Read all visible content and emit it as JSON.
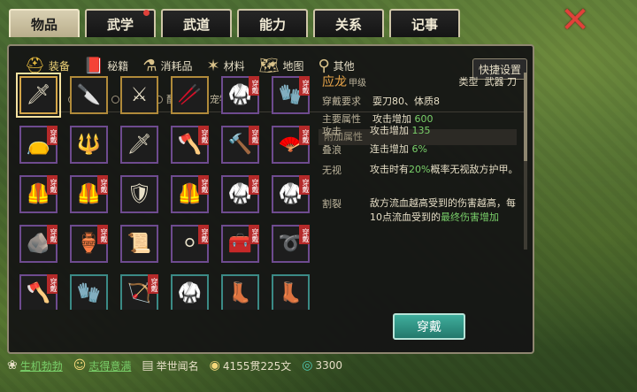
{
  "top_tabs": [
    {
      "label": "物品",
      "active": true
    },
    {
      "label": "武学",
      "dot": true
    },
    {
      "label": "武道"
    },
    {
      "label": "能力"
    },
    {
      "label": "关系"
    },
    {
      "label": "记事"
    }
  ],
  "close_icon": "✕",
  "sub_tabs": [
    {
      "label": "装备",
      "icon": "helmet-icon",
      "glyph": "⛑",
      "active": true
    },
    {
      "label": "秘籍",
      "icon": "book-icon",
      "glyph": "📕"
    },
    {
      "label": "消耗品",
      "icon": "flask-icon",
      "glyph": "⚗"
    },
    {
      "label": "材料",
      "icon": "branch-icon",
      "glyph": "✶"
    },
    {
      "label": "地图",
      "icon": "map-icon",
      "glyph": "🗺"
    },
    {
      "label": "其他",
      "icon": "misc-icon",
      "glyph": "⚲"
    }
  ],
  "shortcut_label": "快捷设置",
  "filters": [
    {
      "label": "全部",
      "active": true
    },
    {
      "label": "武器"
    },
    {
      "label": "内甲"
    },
    {
      "label": "配饰"
    },
    {
      "label": "宠物装备"
    }
  ],
  "worn_badge": "穿戴",
  "items": [
    {
      "name": "sword-item",
      "glyph": "🗡",
      "border": "gold",
      "worn": false,
      "selected": true
    },
    {
      "name": "dagger-item",
      "glyph": "🔪",
      "border": "gold",
      "worn": false
    },
    {
      "name": "blade-item",
      "glyph": "⚔",
      "border": "gold",
      "worn": false
    },
    {
      "name": "staff-item",
      "glyph": "🥢",
      "border": "gold",
      "worn": false
    },
    {
      "name": "robe-item",
      "glyph": "🥋",
      "border": "purple",
      "worn": true
    },
    {
      "name": "bracer-item",
      "glyph": "🧤",
      "border": "purple",
      "worn": true
    },
    {
      "name": "pouch-item",
      "glyph": "👝",
      "border": "purple",
      "worn": true
    },
    {
      "name": "spear-item",
      "glyph": "🔱",
      "border": "purple",
      "worn": false
    },
    {
      "name": "glaive-item",
      "glyph": "🗡",
      "border": "purple",
      "worn": false
    },
    {
      "name": "broadsword-item",
      "glyph": "🪓",
      "border": "purple",
      "worn": true
    },
    {
      "name": "mace-item",
      "glyph": "🔨",
      "border": "purple",
      "worn": true
    },
    {
      "name": "fan-item",
      "glyph": "🪭",
      "border": "purple",
      "worn": true
    },
    {
      "name": "armor-1",
      "glyph": "🦺",
      "border": "purple",
      "worn": true
    },
    {
      "name": "armor-2",
      "glyph": "🦺",
      "border": "purple",
      "worn": true
    },
    {
      "name": "armor-3",
      "glyph": "🛡",
      "border": "purple",
      "worn": false
    },
    {
      "name": "armor-4",
      "glyph": "🦺",
      "border": "purple",
      "worn": true
    },
    {
      "name": "armor-5",
      "glyph": "🥋",
      "border": "purple",
      "worn": true
    },
    {
      "name": "armor-6",
      "glyph": "🥋",
      "border": "purple",
      "worn": true
    },
    {
      "name": "jade-item",
      "glyph": "🪨",
      "border": "purple",
      "worn": true
    },
    {
      "name": "jar-item",
      "glyph": "🏺",
      "border": "purple",
      "worn": true
    },
    {
      "name": "scroll-item",
      "glyph": "📜",
      "border": "purple",
      "worn": false
    },
    {
      "name": "pearl-item",
      "glyph": "⚪",
      "border": "purple",
      "worn": true
    },
    {
      "name": "chest-item",
      "glyph": "🧰",
      "border": "purple",
      "worn": true
    },
    {
      "name": "whip-item",
      "glyph": "➰",
      "border": "purple",
      "worn": true
    },
    {
      "name": "axe-item",
      "glyph": "🪓",
      "border": "purple",
      "worn": true
    },
    {
      "name": "gauntlet-item",
      "glyph": "🧤",
      "border": "teal",
      "worn": false
    },
    {
      "name": "rod-item",
      "glyph": "🏹",
      "border": "teal",
      "worn": true
    },
    {
      "name": "garment-item",
      "glyph": "🥋",
      "border": "teal",
      "worn": false
    },
    {
      "name": "boots-1",
      "glyph": "👢",
      "border": "teal",
      "worn": false
    },
    {
      "name": "boots-2",
      "glyph": "👢",
      "border": "teal",
      "worn": false
    }
  ],
  "detail": {
    "name": "应龙",
    "grade": "甲级",
    "type_label": "类型",
    "type_value": "武器 刀",
    "req_label": "穿戴要求",
    "req_value": "耍刀80、体质8",
    "main_label": "主要属性",
    "main_text": "攻击增加",
    "main_value": "600",
    "extra_head": "附加属性",
    "attrs": [
      {
        "key": "攻击",
        "pre": "攻击增加 ",
        "hl": "135",
        "post": ""
      },
      {
        "key": "叠浪",
        "pre": "连击增加 ",
        "hl": "6%",
        "post": ""
      },
      {
        "key": "无视",
        "pre": "攻击时有",
        "hl": "20%",
        "post": "概率无视敌方护甲。"
      },
      {
        "key": "割裂",
        "pre": "敌方流血越高受到的伤害越高，每10点流血受到的",
        "hl": "最终伤害增加",
        "post": ""
      }
    ]
  },
  "wear_button": "穿戴",
  "status": {
    "s1": "生机勃勃",
    "s2": "志得意满",
    "s3": "举世闻名",
    "money": "4155贯225文",
    "jade": "3300"
  }
}
